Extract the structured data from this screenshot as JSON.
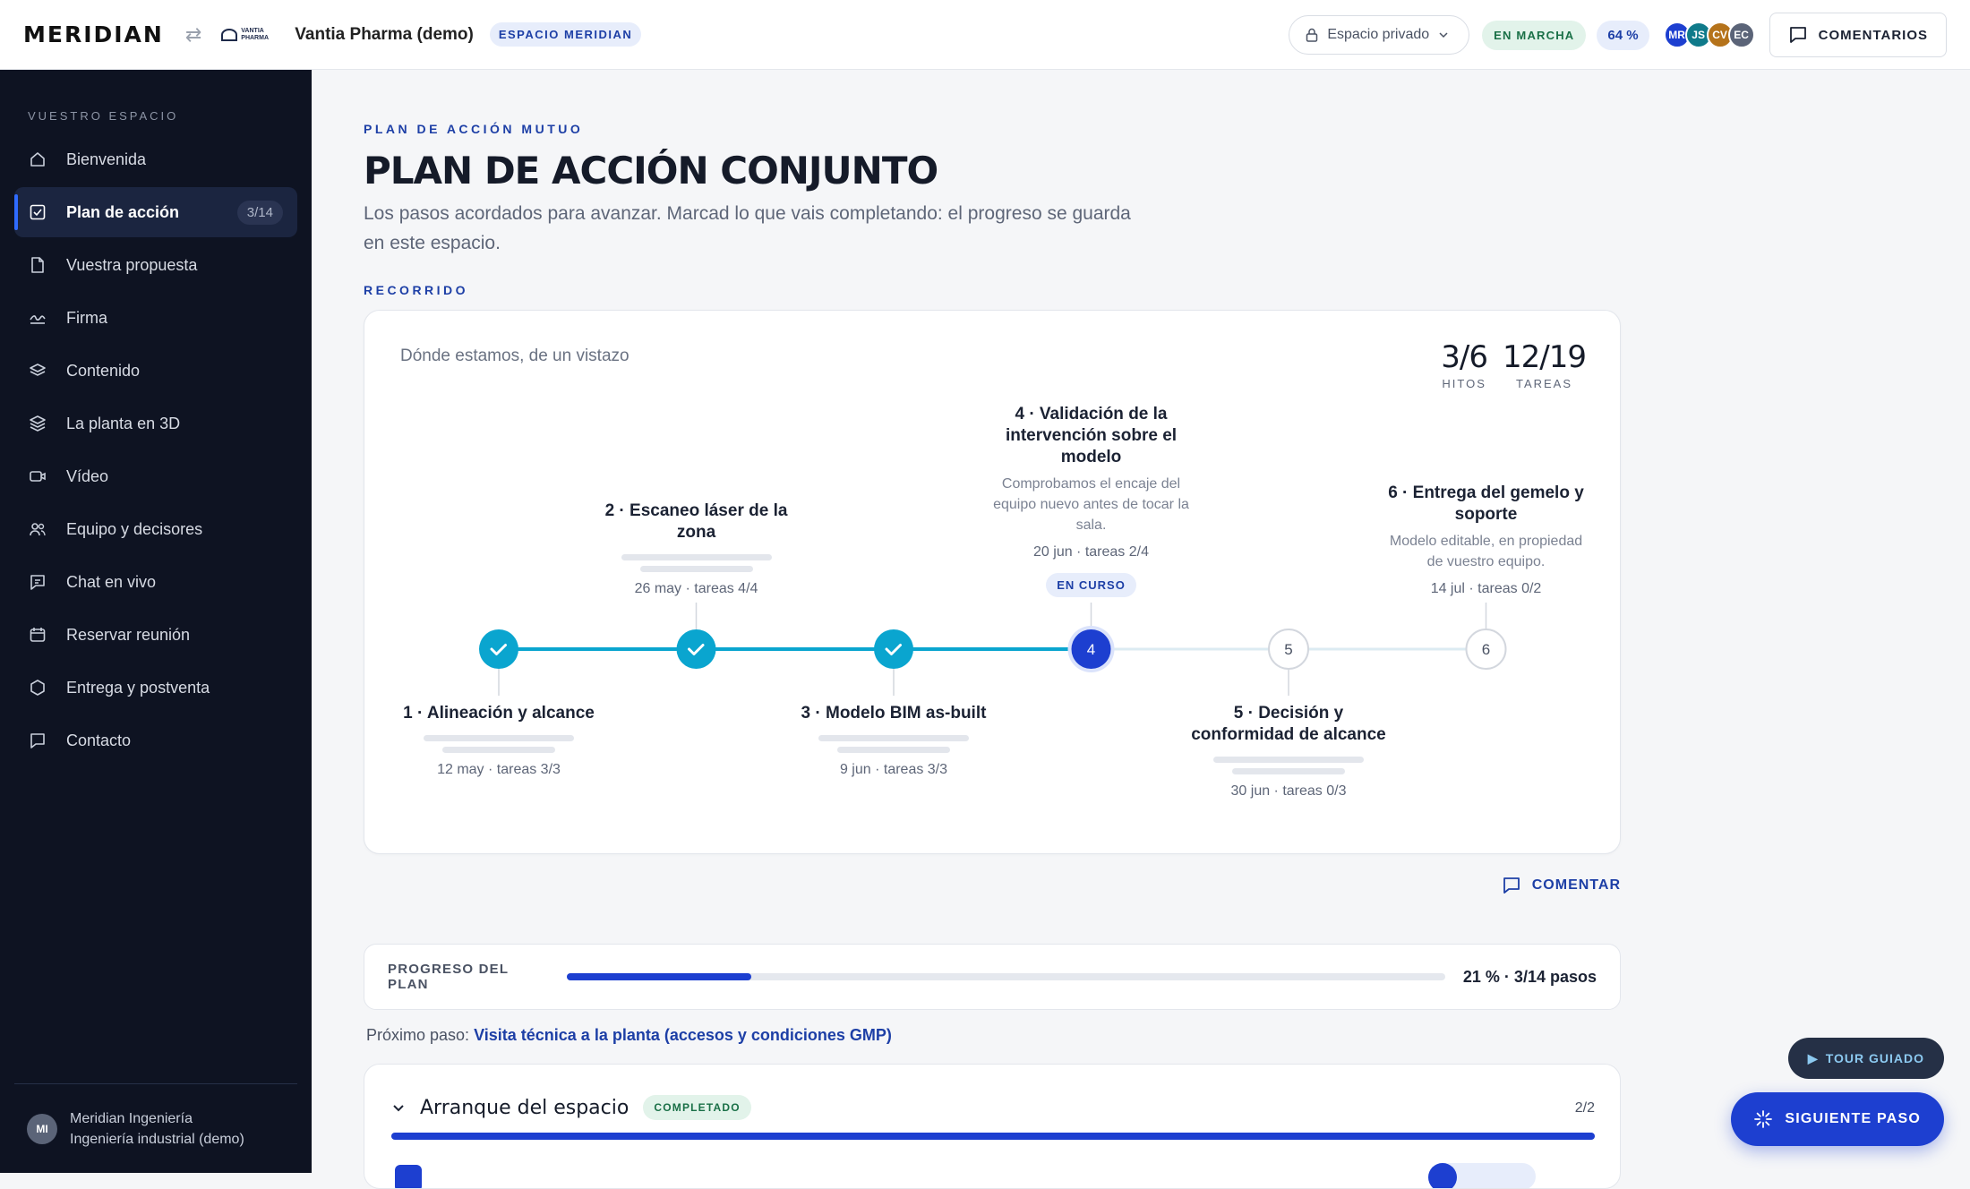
{
  "topbar": {
    "brand": "MERIDIAN",
    "client_logo_text": "VANTIA PHARMA",
    "client_name": "Vantia Pharma (demo)",
    "space_badge": "ESPACIO MERIDIAN",
    "privacy_label": "Espacio privado",
    "status": "EN MARCHA",
    "percent": "64 %",
    "avatars": [
      {
        "initials": "MR",
        "color": "#1d3fd0"
      },
      {
        "initials": "JS",
        "color": "#0f7a8a"
      },
      {
        "initials": "CV",
        "color": "#b5731b"
      },
      {
        "initials": "EC",
        "color": "#5b6478"
      }
    ],
    "comments_label": "COMENTARIOS"
  },
  "sidebar": {
    "heading": "VUESTRO ESPACIO",
    "items": [
      {
        "label": "Bienvenida",
        "icon": "home-icon"
      },
      {
        "label": "Plan de acción",
        "icon": "checklist-icon",
        "count": "3/14",
        "active": true
      },
      {
        "label": "Vuestra propuesta",
        "icon": "document-icon"
      },
      {
        "label": "Firma",
        "icon": "signature-icon"
      },
      {
        "label": "Contenido",
        "icon": "layers-icon"
      },
      {
        "label": "La planta en 3D",
        "icon": "stack-3d-icon"
      },
      {
        "label": "Vídeo",
        "icon": "video-icon"
      },
      {
        "label": "Equipo y decisores",
        "icon": "team-icon"
      },
      {
        "label": "Chat en vivo",
        "icon": "chat-icon"
      },
      {
        "label": "Reservar reunión",
        "icon": "calendar-icon"
      },
      {
        "label": "Entrega y postventa",
        "icon": "hexagon-icon"
      },
      {
        "label": "Contacto",
        "icon": "message-icon"
      }
    ],
    "footer": {
      "initials": "MI",
      "org": "Meridian Ingeniería",
      "org_sub": "Ingeniería industrial (demo)"
    }
  },
  "main": {
    "eyebrow": "PLAN DE ACCIÓN MUTUO",
    "title": "PLAN DE ACCIÓN CONJUNTO",
    "description": "Los pasos acordados para avanzar. Marcad lo que vais completando: el progreso se guarda en este espacio.",
    "section_label": "RECORRIDO",
    "overview": {
      "subtitle": "Dónde estamos, de un vistazo",
      "kpis": [
        {
          "value": "3/6",
          "label": "HITOS"
        },
        {
          "value": "12/19",
          "label": "TAREAS"
        }
      ],
      "milestones": [
        {
          "number": "1",
          "title": "1 · Alineación y alcance",
          "date": "12 may · tareas 3/3",
          "state": "done",
          "position": "below"
        },
        {
          "number": "2",
          "title": "2 · Escaneo láser de la zona",
          "date": "26 may · tareas 4/4",
          "state": "done",
          "position": "above"
        },
        {
          "number": "3",
          "title": "3 · Modelo BIM as-built",
          "date": "9 jun · tareas 3/3",
          "state": "done",
          "position": "below"
        },
        {
          "number": "4",
          "title": "4 · Validación de la intervención sobre el modelo",
          "description": "Comprobamos el encaje del equipo nuevo antes de tocar la sala.",
          "date": "20 jun · tareas 2/4",
          "badge": "EN CURSO",
          "state": "current",
          "position": "above"
        },
        {
          "number": "5",
          "title": "5 · Decisión y conformidad de alcance",
          "date": "30 jun · tareas 0/3",
          "state": "pending",
          "position": "below"
        },
        {
          "number": "6",
          "title": "6 · Entrega del gemelo y soporte",
          "description": "Modelo editable, en propiedad de vuestro equipo.",
          "date": "14 jul · tareas 0/2",
          "state": "pending",
          "position": "above"
        }
      ]
    },
    "comment_label": "COMENTAR",
    "progress": {
      "label": "PROGRESO DEL PLAN",
      "fraction": 0.21,
      "value_text": "21 % · 3/14 pasos"
    },
    "next_step": {
      "prefix": "Próximo paso:",
      "link": "Visita técnica a la planta (accesos y condiciones GMP)"
    },
    "phase": {
      "title": "Arranque del espacio",
      "badge": "COMPLETADO",
      "count": "2/2"
    }
  },
  "floating": {
    "tour_label": "TOUR GUIADO",
    "next_label": "SIGUIENTE PASO"
  },
  "colors": {
    "accent": "#1d3fd0",
    "timeline_done": "#0aa5cf",
    "sidebar_bg": "#0e1322"
  }
}
